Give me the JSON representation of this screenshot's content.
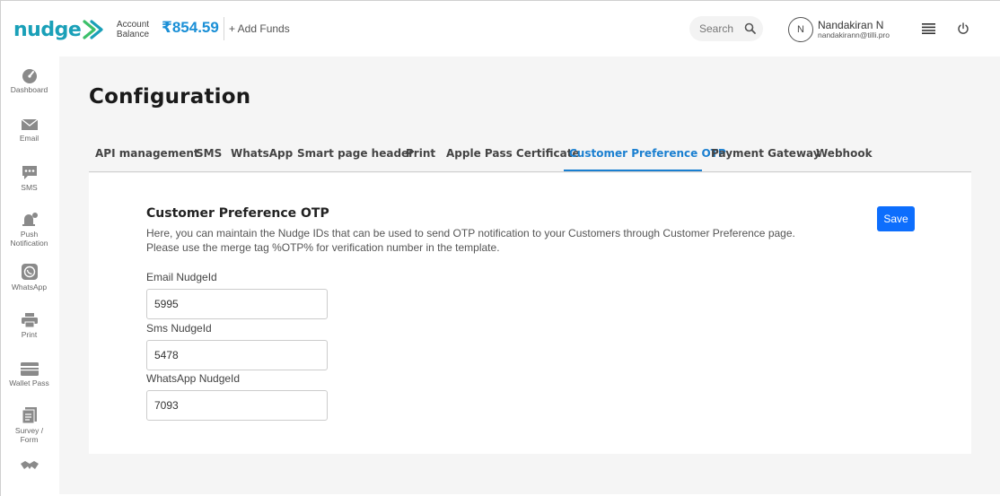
{
  "header": {
    "logo_text": "nudge",
    "account_label_line1": "Account",
    "account_label_line2": "Balance",
    "balance": "₹854.59",
    "add_funds": "+ Add Funds",
    "search_placeholder": "Search",
    "user_initial": "N",
    "user_name": "Nandakiran N",
    "user_email": "nandakirann@tilli.pro"
  },
  "sidebar": {
    "items": [
      {
        "label": "Dashboard",
        "icon": "dashboard-icon"
      },
      {
        "label": "Email",
        "icon": "envelope-icon"
      },
      {
        "label": "SMS",
        "icon": "chat-bubble-icon"
      },
      {
        "label_line1": "Push",
        "label_line2": "Notification",
        "icon": "push-notification-icon"
      },
      {
        "label": "WhatsApp",
        "icon": "whatsapp-icon"
      },
      {
        "label": "Print",
        "icon": "printer-icon"
      },
      {
        "label": "Wallet Pass",
        "icon": "wallet-icon"
      },
      {
        "label_line1": "Survey /",
        "label_line2": "Form",
        "icon": "survey-icon"
      },
      {
        "icon": "handshake-icon"
      }
    ]
  },
  "page": {
    "title": "Configuration"
  },
  "tabs": [
    {
      "label": "API management"
    },
    {
      "label": "SMS"
    },
    {
      "label": "WhatsApp"
    },
    {
      "label": "Smart page header"
    },
    {
      "label": "Print"
    },
    {
      "label": "Apple Pass Certificate"
    },
    {
      "label": "Customer Preference OTP",
      "active": true
    },
    {
      "label": "Payment Gateway"
    },
    {
      "label": "Webhook"
    }
  ],
  "section": {
    "title": "Customer Preference OTP",
    "desc_line1": "Here, you can maintain the Nudge IDs that can be used to send OTP notification to your Customers through Customer Preference page.",
    "desc_line2": "Please use the merge tag %OTP% for verification number in the template.",
    "save_label": "Save",
    "fields": [
      {
        "label": "Email NudgeId",
        "value": "5995"
      },
      {
        "label": "Sms NudgeId",
        "value": "5478"
      },
      {
        "label": "WhatsApp NudgeId",
        "value": "7093"
      }
    ]
  },
  "colors": {
    "accent": "#1a7fd0",
    "save_button": "#0d6efd",
    "balance": "#1a8fd6",
    "logo": "#1aa0b8",
    "logo_arrow": "#3cc06a"
  }
}
